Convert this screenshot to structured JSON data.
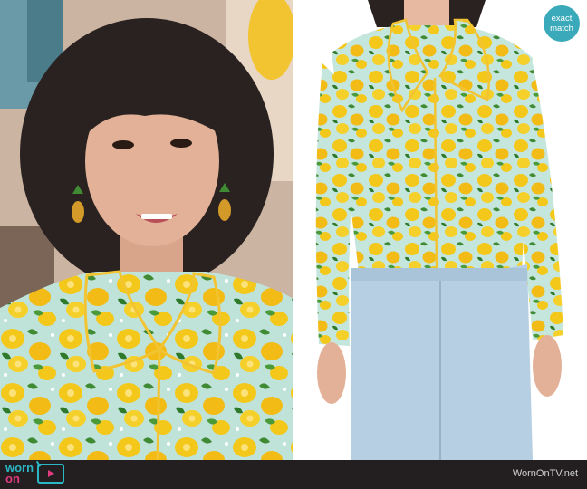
{
  "left_image": {
    "alt": "Woman with bangs wearing lemon print shirt with scalloped yellow-trimmed collar"
  },
  "right_image": {
    "alt": "Model wearing lemon print button-up shirt tucked into light wash jeans"
  },
  "badge": {
    "line1": "exact",
    "line2": "match"
  },
  "footer": {
    "logo_word1": "worn",
    "logo_word2": "on",
    "site_name": "WornOnTV.net"
  },
  "colors": {
    "badge": "#3aa9b9",
    "footer_bg": "#231f20",
    "brand_teal": "#2bb7c6",
    "brand_pink": "#e23b7f",
    "lemon": "#f4c81a",
    "leaf": "#3f8a32",
    "shirt_bg": "#bfe3d9",
    "denim": "#b6cfe3"
  }
}
